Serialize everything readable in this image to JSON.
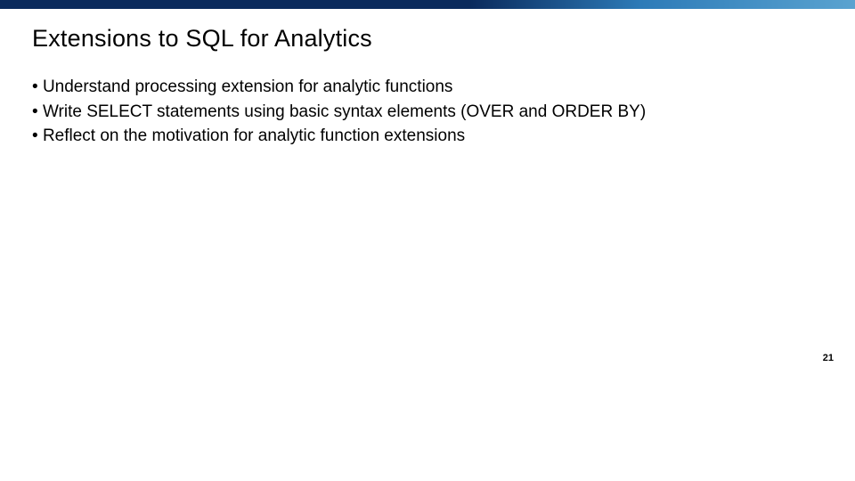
{
  "slide": {
    "title": "Extensions to SQL for Analytics",
    "bullets": [
      "Understand processing extension for analytic functions",
      "Write SELECT statements using basic syntax elements (OVER and ORDER BY)",
      "Reflect on the motivation for analytic function extensions"
    ],
    "page_number": "21"
  },
  "colors": {
    "bar_dark": "#0a2a5c",
    "bar_light": "#5aa3d0"
  }
}
